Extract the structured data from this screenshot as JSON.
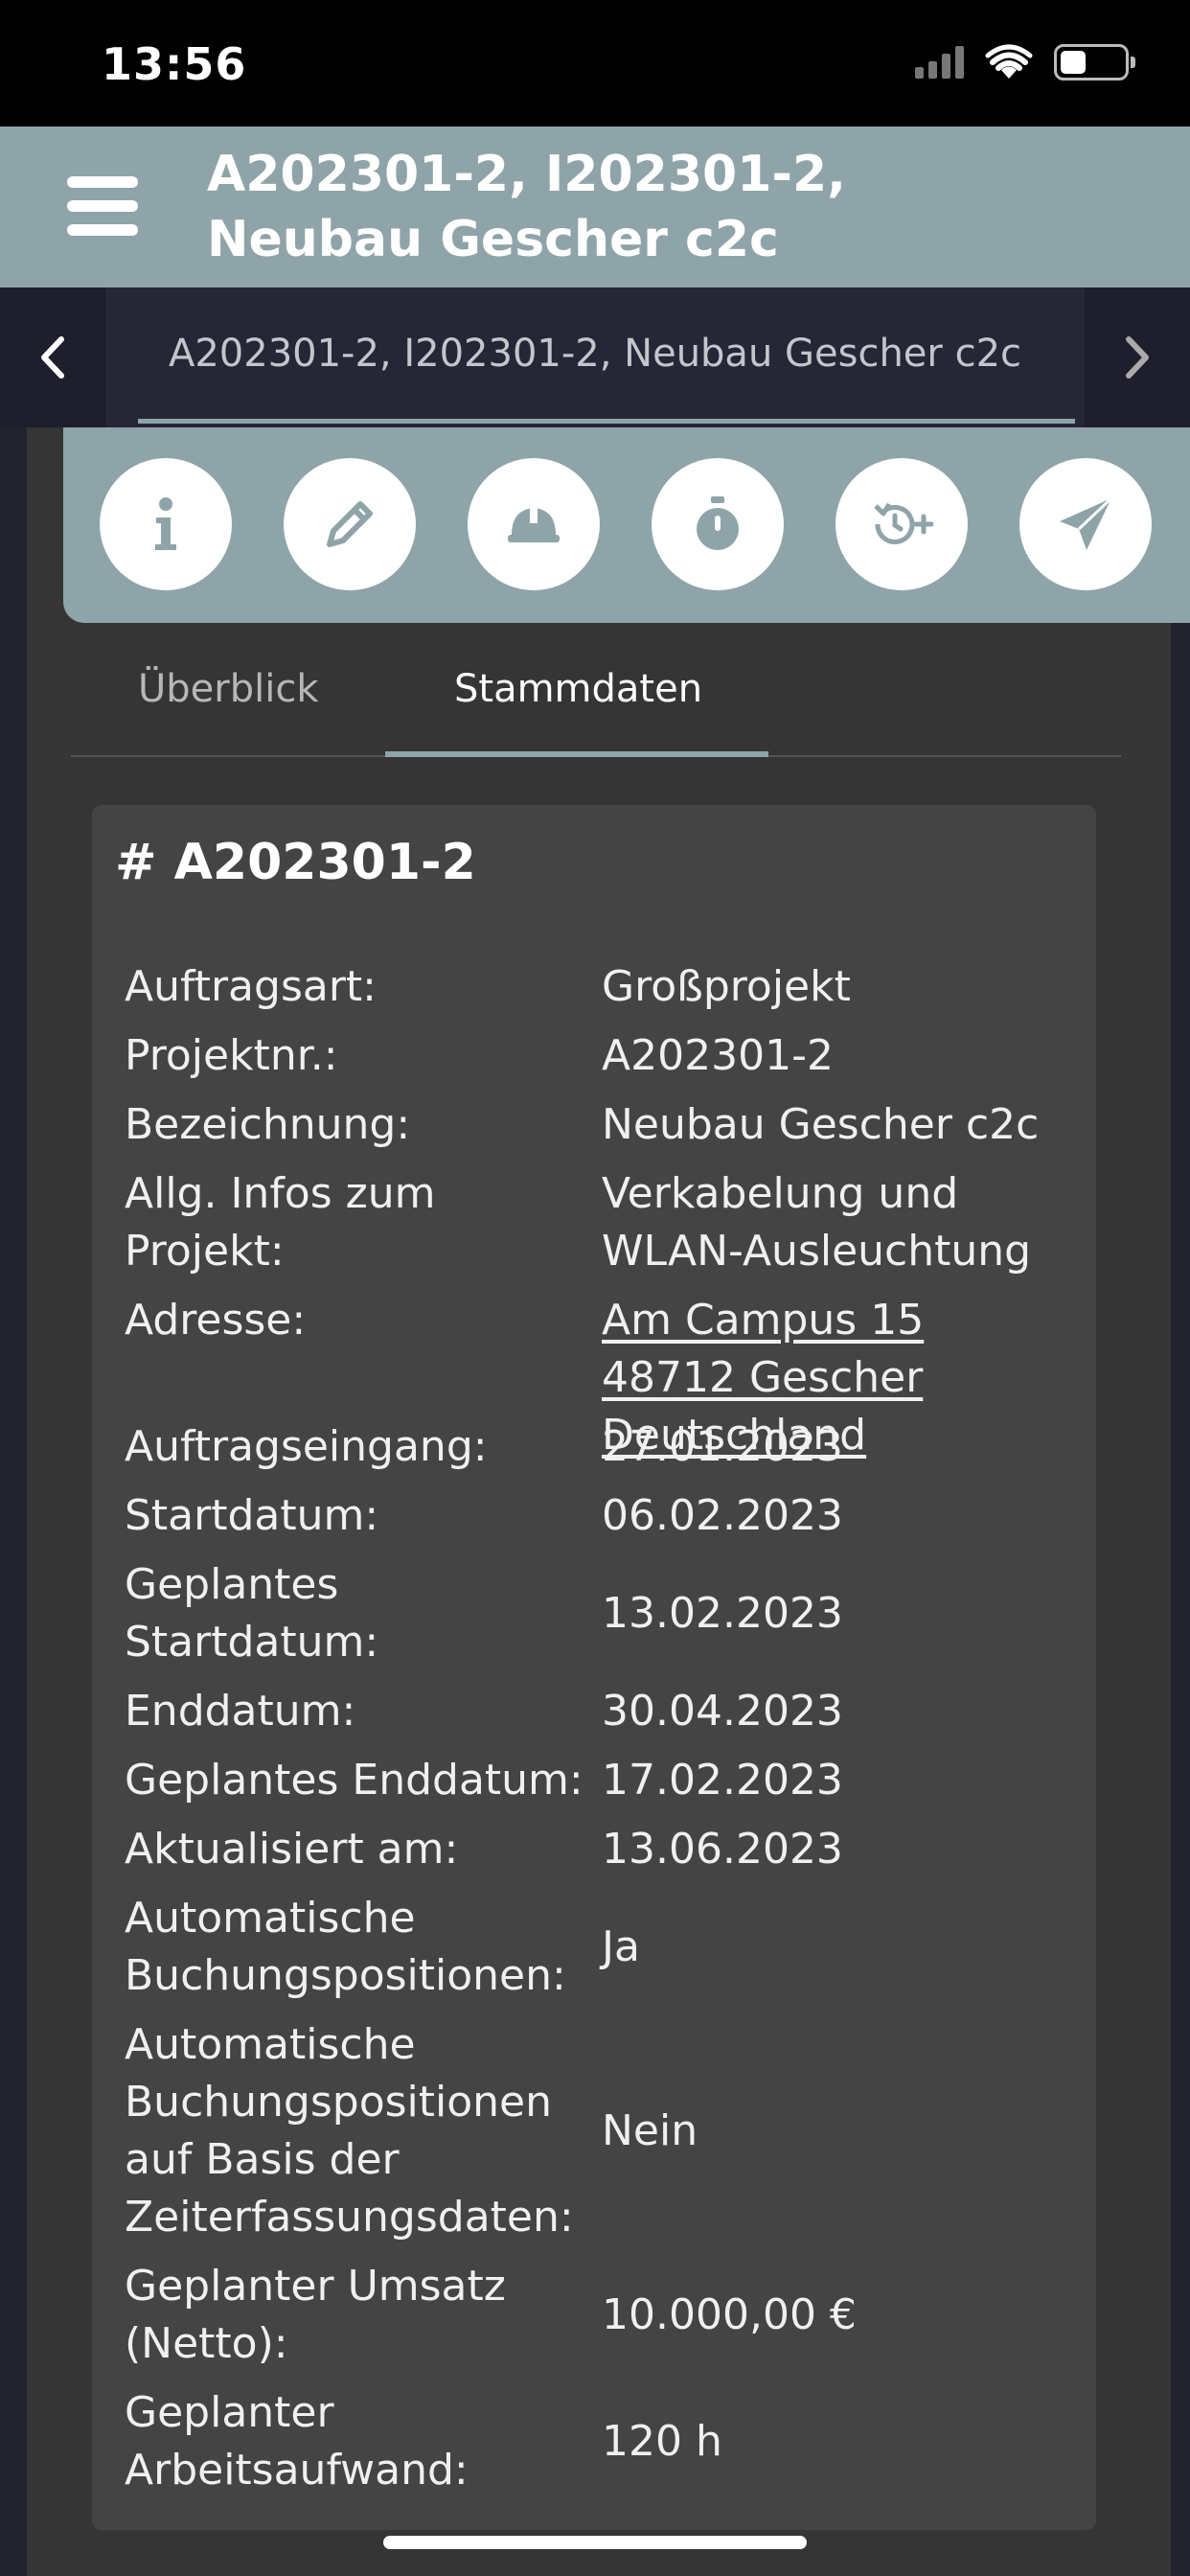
{
  "status_bar": {
    "time": "13:56"
  },
  "header": {
    "title_line1": "A202301-2, I202301-2,",
    "title_line2": "Neubau Gescher c2c"
  },
  "subnav": {
    "label": "A202301-2, I202301-2, Neubau Gescher c2c"
  },
  "action_icons": [
    "info-icon",
    "pencil-icon",
    "helmet-icon",
    "stopwatch-icon",
    "history-add-icon",
    "send-icon"
  ],
  "tabs": {
    "overview": "Überblick",
    "stammdaten": "Stammdaten"
  },
  "card": {
    "title": "# A202301-2",
    "rows": [
      {
        "key": "Auftragsart:",
        "value": "Großprojekt"
      },
      {
        "key": "Projektnr.:",
        "value": "A202301-2"
      },
      {
        "key": "Bezeichnung:",
        "value": "Neubau Gescher c2c"
      },
      {
        "key": "Allg. Infos zum Projekt:",
        "value": "Verkabelung und WLAN-Ausleuchtung"
      },
      {
        "key": "Adresse:",
        "value": "Am Campus 15 48712 Gescher Deutschland"
      },
      {
        "key": "Auftragseingang:",
        "value": "27.01.2023"
      },
      {
        "key": "Startdatum:",
        "value": "06.02.2023"
      },
      {
        "key": "Geplantes Startdatum:",
        "value": "13.02.2023"
      },
      {
        "key": "Enddatum:",
        "value": "30.04.2023"
      },
      {
        "key": "Geplantes Enddatum:",
        "value": "17.02.2023"
      },
      {
        "key": "Aktualisiert am:",
        "value": "13.06.2023"
      },
      {
        "key": "Automatische Buchungspositionen:",
        "value": "Ja"
      },
      {
        "key": "Automatische Buchungspositionen auf Basis der Zeiterfassungsdaten:",
        "value": "Nein"
      },
      {
        "key": "Geplanter Umsatz (Netto):",
        "value": "10.000,00 €"
      },
      {
        "key": "Geplanter Arbeitsaufwand:",
        "value": "120 h"
      }
    ]
  },
  "colors": {
    "accent": "#8fa4a8",
    "card_bg": "#444444",
    "panel_bg": "#353535"
  }
}
